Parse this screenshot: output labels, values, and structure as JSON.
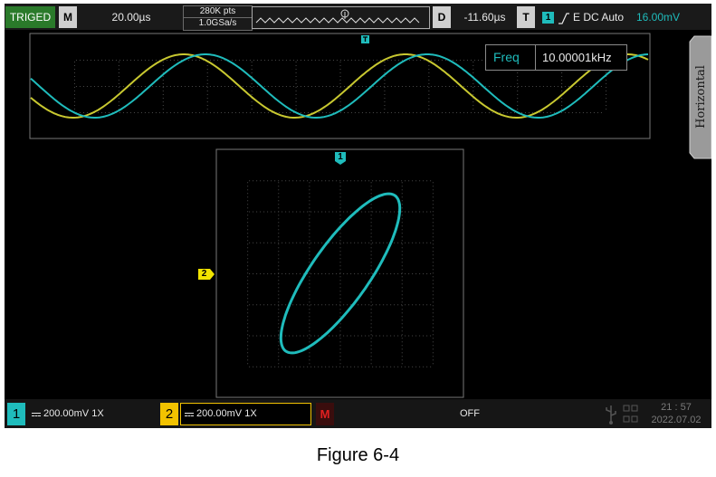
{
  "top_bar": {
    "trig_status": "TRIGED",
    "mode_key": "M",
    "timebase": "20.00µs",
    "mem_depth": "280K pts",
    "sample_rate": "1.0GSa/s",
    "delay_key": "D",
    "delay_value": "-11.60µs",
    "trig_key": "T",
    "trig_channel": "1",
    "trig_settings": "E DC Auto",
    "trig_level": "16.00mV"
  },
  "main_window": {
    "measure_label": "Freq",
    "measure_value": "10.00001kHz",
    "side_tab": "Horizontal"
  },
  "xy_window": {
    "ch1_marker": "1",
    "ch2_marker": "2"
  },
  "bottom_bar": {
    "ch1_index": "1",
    "ch1_scale": "200.00mV 1X",
    "ch2_index": "2",
    "ch2_scale": "200.00mV 1X",
    "math_key": "M",
    "ref_state": "OFF",
    "time": "21 : 57",
    "date": "2022.07.02"
  },
  "caption": "Figure 6-4",
  "colors": {
    "ch1": "#1fbcbc",
    "ch2": "#c8c830",
    "trig_green": "#2a7a2a",
    "accent_yellow": "#f2c200"
  }
}
